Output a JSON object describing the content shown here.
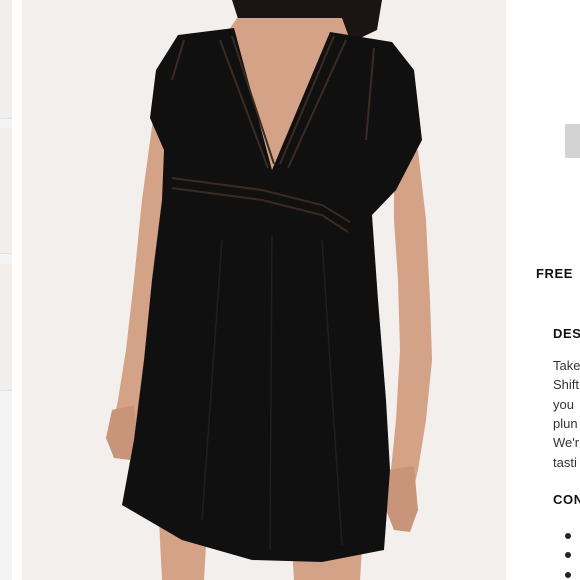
{
  "info_panel": {
    "shipping_banner": "FREE",
    "description_heading": "DES",
    "description_lines": [
      "Take",
      "Shift",
      "you",
      "plun",
      "We'r",
      "tasti"
    ],
    "contents_heading": "CON",
    "content_bullet_count": 3
  },
  "colors": {
    "image_background": "#f2efed",
    "dress": "#101010",
    "skin": "#d4a286",
    "button": "#d3d3d3"
  },
  "icons": {
    "bullet": "filled-circle"
  }
}
